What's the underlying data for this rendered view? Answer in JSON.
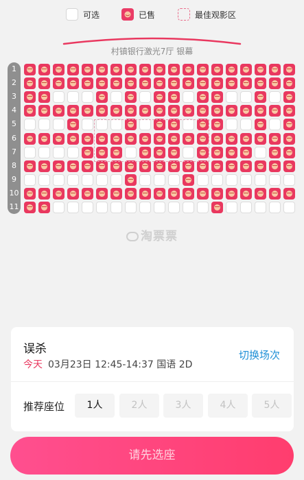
{
  "legend": {
    "available": "可选",
    "sold": "已售",
    "best_zone": "最佳观影区"
  },
  "screen": {
    "hall_name": "村镇银行激光7厅 银幕"
  },
  "rows": [
    "1",
    "2",
    "3",
    "4",
    "5",
    "6",
    "7",
    "8",
    "9",
    "10",
    "11"
  ],
  "seats": [
    "SSSSSSSSSSSSSSSSSSS",
    "SSSSSSSSSSSSSSSSSSS",
    "SSAAASASASSASSAASAS",
    "SSSSSSSSSSSSSSSSSSS",
    "AAASAAASASSASSAASAS",
    "SSSSSSSSSSSSSSSSSSS",
    "AAAASSSASSSASSSSASS",
    "SSSSSSSSSSSSSSSSSSS",
    "AAAAAAASAAASAAAAAAA",
    "SSSSSSSSSSSSSSSSSSS",
    "SSAAAAAAAAAAASAAAAA"
  ],
  "watermark": "淘票票",
  "show": {
    "title": "误杀",
    "day": "今天",
    "details": "03月23日 12:45-14:37 国语 2D",
    "switch_label": "切换场次"
  },
  "recommend": {
    "label": "推荐座位",
    "options": [
      "1人",
      "2人",
      "3人",
      "4人",
      "5人"
    ]
  },
  "cta_label": "请先选座",
  "colors": {
    "sold": "#e9385f",
    "accent_blue": "#1e8fd6",
    "cta": "#ff4080"
  }
}
